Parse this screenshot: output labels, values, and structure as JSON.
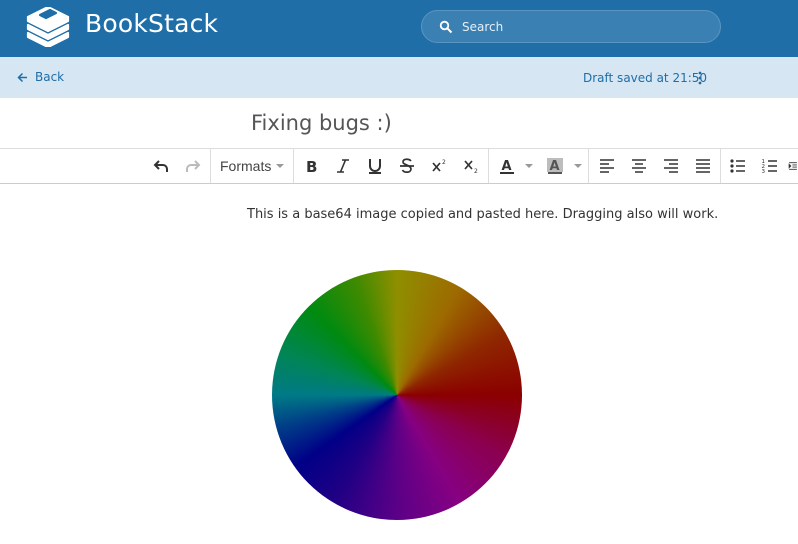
{
  "header": {
    "app_name": "BookStack",
    "search_placeholder": "Search",
    "icons": [
      "bookstack-logo",
      "search-icon"
    ]
  },
  "subbar": {
    "back_label": "Back",
    "draft_status": "Draft saved at 21:50"
  },
  "editor": {
    "title": "Fixing bugs :)",
    "toolbar": {
      "formats_label": "Formats",
      "buttons": [
        "undo",
        "redo",
        "bold",
        "italic",
        "underline",
        "strikethrough",
        "superscript",
        "subscript",
        "text-color",
        "background-color",
        "align-left",
        "align-center",
        "align-right",
        "justify",
        "bullet-list",
        "numbered-list",
        "indent"
      ]
    },
    "content": {
      "paragraph": "This is a base64 image copied and pasted here. Dragging also will work.",
      "image": "color-wheel"
    }
  },
  "colors": {
    "header_bg": "#206ea7",
    "subbar_bg": "#d6e6f3",
    "accent": "#206ea7"
  }
}
